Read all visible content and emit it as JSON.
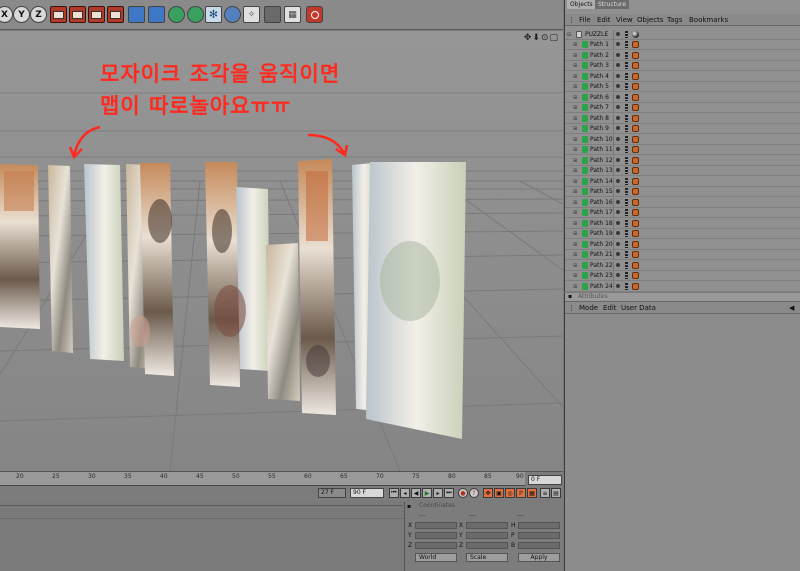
{
  "toolbar": {
    "buttons": [
      {
        "name": "undo-button",
        "label": "",
        "icon": "undo-icon"
      },
      {
        "name": "axis-x-button",
        "label": "X",
        "icon": "axis-x-icon"
      },
      {
        "name": "axis-y-button",
        "label": "Y",
        "icon": "axis-y-icon"
      },
      {
        "name": "axis-z-button",
        "label": "Z",
        "icon": "axis-z-icon"
      },
      {
        "name": "coord-system-button",
        "label": "",
        "icon": "coordinate-system-icon"
      },
      {
        "name": "render-view-button",
        "label": "",
        "icon": "render-view-icon"
      },
      {
        "name": "render-picture-viewer-button",
        "label": "",
        "icon": "picture-viewer-icon"
      },
      {
        "name": "render-settings-button",
        "label": "",
        "icon": "render-settings-icon"
      },
      {
        "name": "cube-button",
        "label": "",
        "icon": "cube-icon"
      },
      {
        "name": "subdivision-button",
        "label": "",
        "icon": "subdivision-icon"
      },
      {
        "name": "array-button",
        "label": "",
        "icon": "array-icon"
      },
      {
        "name": "deformer-button",
        "label": "",
        "icon": "deformer-icon"
      },
      {
        "name": "particle-button",
        "label": "",
        "icon": "particle-icon"
      },
      {
        "name": "camera-button",
        "label": "",
        "icon": "camera-icon"
      },
      {
        "name": "light-button",
        "label": "",
        "icon": "light-icon"
      },
      {
        "name": "snap-button",
        "label": "",
        "icon": "snap-icon"
      },
      {
        "name": "layout-button",
        "label": "",
        "icon": "layout-icon"
      },
      {
        "name": "record-button",
        "label": "",
        "icon": "record-icon"
      }
    ]
  },
  "viewport": {
    "nav_icons": "✥⬇⊙▢",
    "annotation_line1": "모자이크 조각을 움직이면",
    "annotation_line2": "맵이 따로놀아요ㅠㅠ",
    "annotation_color": "#ff2a1f"
  },
  "timeline": {
    "ticks": [
      "20",
      "25",
      "30",
      "35",
      "40",
      "45",
      "50",
      "55",
      "60",
      "65",
      "70",
      "75",
      "80",
      "85",
      "90"
    ],
    "current_frame": "0 F",
    "end_frame_left": "27 F",
    "end_frame": "90 F"
  },
  "coordinates": {
    "title": "Coordinates",
    "col_position": "---",
    "col_size": "---",
    "col_rotation": "---",
    "x_label": "X",
    "y_label": "Y",
    "z_label": "Z",
    "h_label": "H",
    "p_label": "P",
    "b_label": "B",
    "world_select": "World",
    "scale_select": "Scale",
    "apply_button": "Apply"
  },
  "objects_panel": {
    "tab_objects": "Objects",
    "tab_structure": "Structure",
    "menu": [
      "File",
      "Edit",
      "View",
      "Objects",
      "Tags",
      "Bookmarks"
    ],
    "root": "PUZZLE",
    "items": [
      "Path 1",
      "Path 2",
      "Path 3",
      "Path 4",
      "Path 5",
      "Path 6",
      "Path 7",
      "Path 8",
      "Path 9",
      "Path 10",
      "Path 11",
      "Path 12",
      "Path 13",
      "Path 14",
      "Path 15",
      "Path 16",
      "Path 17",
      "Path 18",
      "Path 19",
      "Path 20",
      "Path 21",
      "Path 22",
      "Path 23",
      "Path 24"
    ]
  },
  "attributes_panel": {
    "title": "Attributes",
    "menu": [
      "Mode",
      "Edit",
      "User Data"
    ],
    "arrow": "◀"
  }
}
